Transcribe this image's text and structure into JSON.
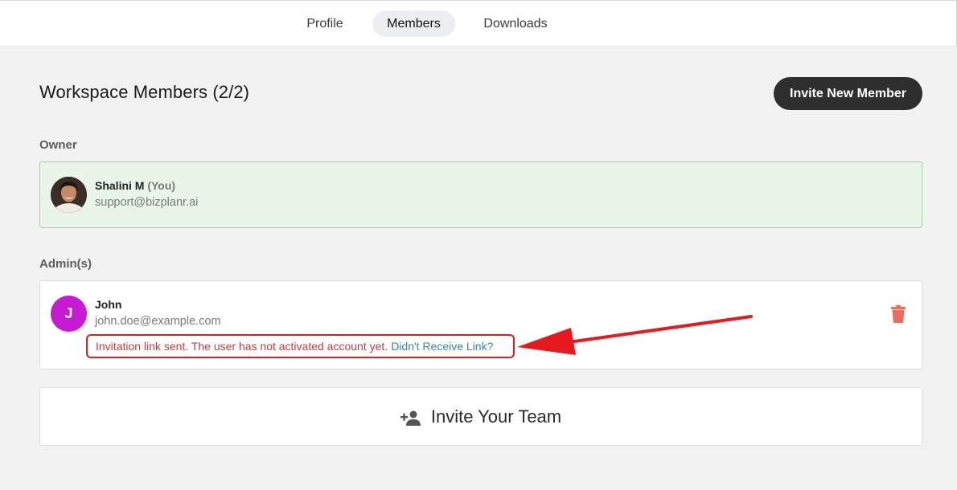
{
  "tabs": [
    {
      "label": "Profile"
    },
    {
      "label": "Members"
    },
    {
      "label": "Downloads"
    }
  ],
  "header": {
    "title": "Workspace Members (2/2)",
    "invite_button": "Invite New Member"
  },
  "owner_section": {
    "label": "Owner",
    "member": {
      "name": "Shalini M",
      "you_tag": "(You)",
      "email": "support@bizplanr.ai"
    }
  },
  "admin_section": {
    "label": "Admin(s)",
    "member": {
      "avatar_letter": "J",
      "name": "John",
      "email": "john.doe@example.com",
      "status_text": "Invitation link sent. The user has not activated account yet.",
      "status_link": "Didn't Receive Link?"
    }
  },
  "invite_team": {
    "label": "Invite Your Team",
    "icon": "person-add-icon"
  },
  "colors": {
    "accent_dark": "#2e2e2e",
    "owner_bg": "#e8f5e8",
    "avatar_purple": "#c71bd3",
    "warning_red": "#e21b1b",
    "link_blue": "#2f86c2",
    "trash_red": "#f06b5b"
  }
}
